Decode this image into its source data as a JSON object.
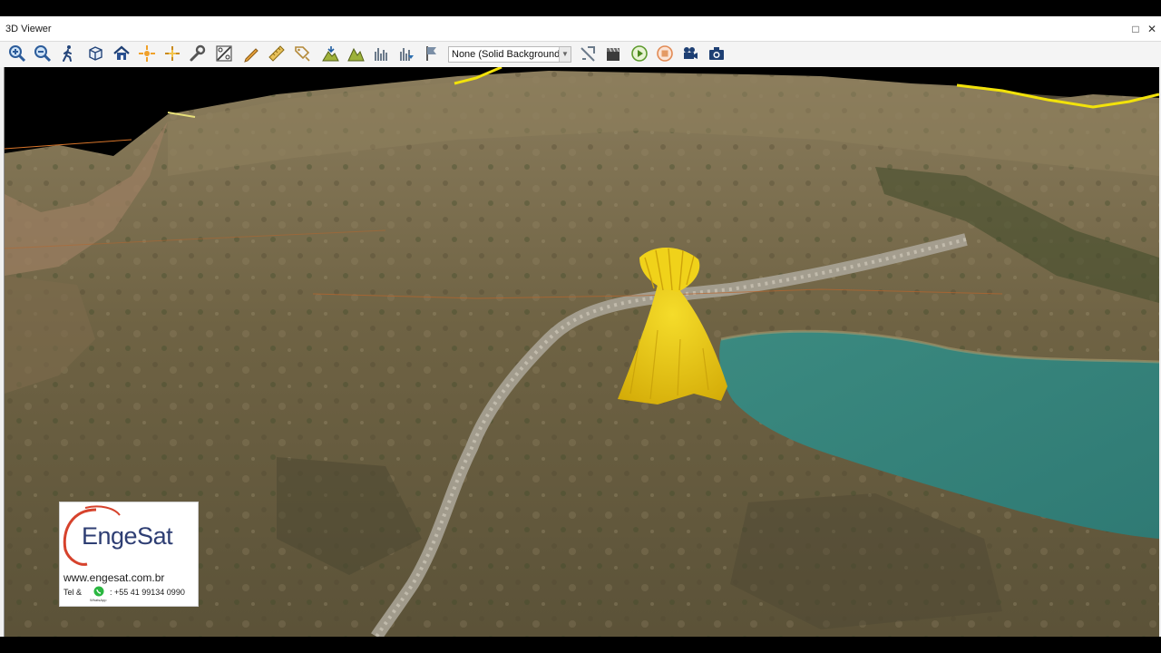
{
  "window": {
    "title": "3D Viewer",
    "restore_glyph": "□",
    "close_glyph": "✕"
  },
  "toolbar": {
    "buttons": [
      {
        "name": "zoom-in-icon"
      },
      {
        "name": "zoom-out-icon"
      },
      {
        "name": "walk-icon"
      },
      {
        "name": "cube-view-icon"
      },
      {
        "name": "home-icon"
      },
      {
        "name": "sun-icon"
      },
      {
        "name": "crosshair-icon"
      },
      {
        "name": "wrench-icon"
      },
      {
        "name": "ratio-icon"
      },
      {
        "name": "pencil-icon"
      },
      {
        "name": "ruler-icon"
      },
      {
        "name": "tag-icon"
      },
      {
        "name": "terrain-pick-icon"
      },
      {
        "name": "terrain-icon"
      },
      {
        "name": "lidar-icon"
      },
      {
        "name": "lidar-filter-icon"
      },
      {
        "name": "flag-icon"
      }
    ],
    "background_select": {
      "value": "None (Solid Background)"
    },
    "buttons_right": [
      {
        "name": "airplane-icon"
      },
      {
        "name": "clapper-icon"
      },
      {
        "name": "play-icon"
      },
      {
        "name": "stop-icon"
      },
      {
        "name": "video-camera-icon"
      },
      {
        "name": "camera-icon"
      }
    ]
  },
  "logo": {
    "brand": "EngeSat",
    "url": "www.engesat.com.br",
    "tel_label": "Tel &",
    "phone": ": +55 41 99134 0990",
    "whatsapp_label": "WhatsApp"
  },
  "colors": {
    "viewshed_yellow": "#e8c20c",
    "lake_teal": "#3d8f87",
    "terrain_base": "#6f6344",
    "brand_blue": "#2e3e73",
    "brand_red": "#d6422c"
  }
}
